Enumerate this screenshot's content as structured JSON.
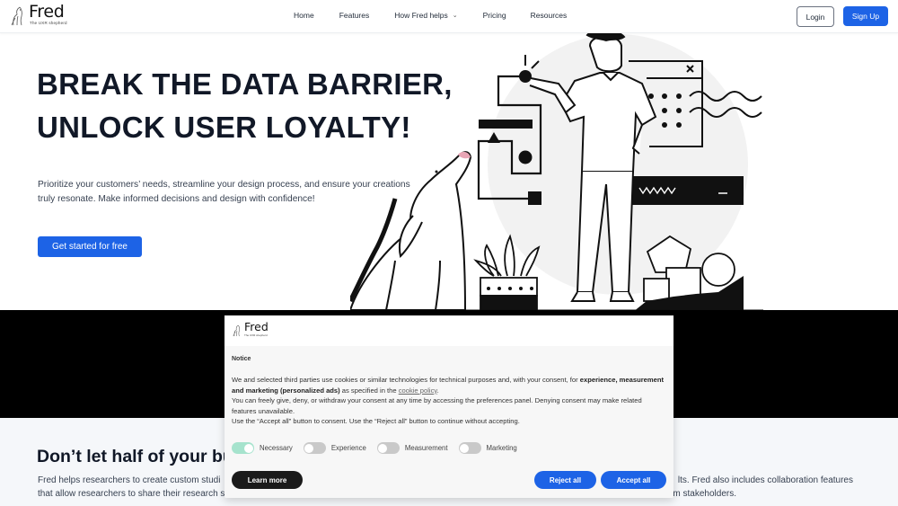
{
  "brand": {
    "name": "Fred",
    "tagline": "The UXR shepherd"
  },
  "nav": {
    "links": [
      {
        "label": "Home"
      },
      {
        "label": "Features"
      },
      {
        "label": "How Fred helps",
        "has_dropdown": true
      },
      {
        "label": "Pricing"
      },
      {
        "label": "Resources"
      }
    ],
    "dropdown_icon": "chevron-down-icon",
    "login_label": "Login",
    "signup_label": "Sign Up"
  },
  "hero": {
    "title_line1": "BREAK THE DATA BARRIER,",
    "title_line2": "UNLOCK USER LOYALTY!",
    "subtitle": "Prioritize your customers’ needs, streamline your design process, and ensure your creations truly resonate. Make informed decisions and design with confidence!",
    "cta_label": "Get started for free",
    "illustration": "person-with-dog-ui-elements-illustration"
  },
  "section2": {
    "title": "Don’t let half of your bu",
    "paragraph_left_line1": "Fred helps researchers to create custom studi",
    "paragraph_left_line2": "that allow researchers to share their research s",
    "paragraph_right_line1": "lts. Fred also includes collaboration features",
    "paragraph_right_line2": "m stakeholders."
  },
  "cookie_notice": {
    "heading": "Notice",
    "text_part1": "We and selected third parties use cookies or similar technologies for technical purposes and, with your consent, for ",
    "text_bold": "experience, measurement and marketing (personalized ads)",
    "text_part2": " as specified in the ",
    "policy_link": "cookie policy",
    "text_part3": ".",
    "text_line2": "You can freely give, deny, or withdraw your consent at any time by accessing the preferences panel. Denying consent may make related features unavailable.",
    "text_line3": "Use the “Accept all” button to consent. Use the “Reject all” button to continue without accepting.",
    "toggles": [
      {
        "label": "Necessary",
        "on": true
      },
      {
        "label": "Experience",
        "on": false
      },
      {
        "label": "Measurement",
        "on": false
      },
      {
        "label": "Marketing",
        "on": false
      }
    ],
    "learn_more_label": "Learn more",
    "reject_label": "Reject all",
    "accept_label": "Accept all"
  },
  "colors": {
    "primary": "#1d63e6",
    "heading": "#111827",
    "toggle_on": "#a6e3cd",
    "dog_nose": "#e8a5b5"
  }
}
